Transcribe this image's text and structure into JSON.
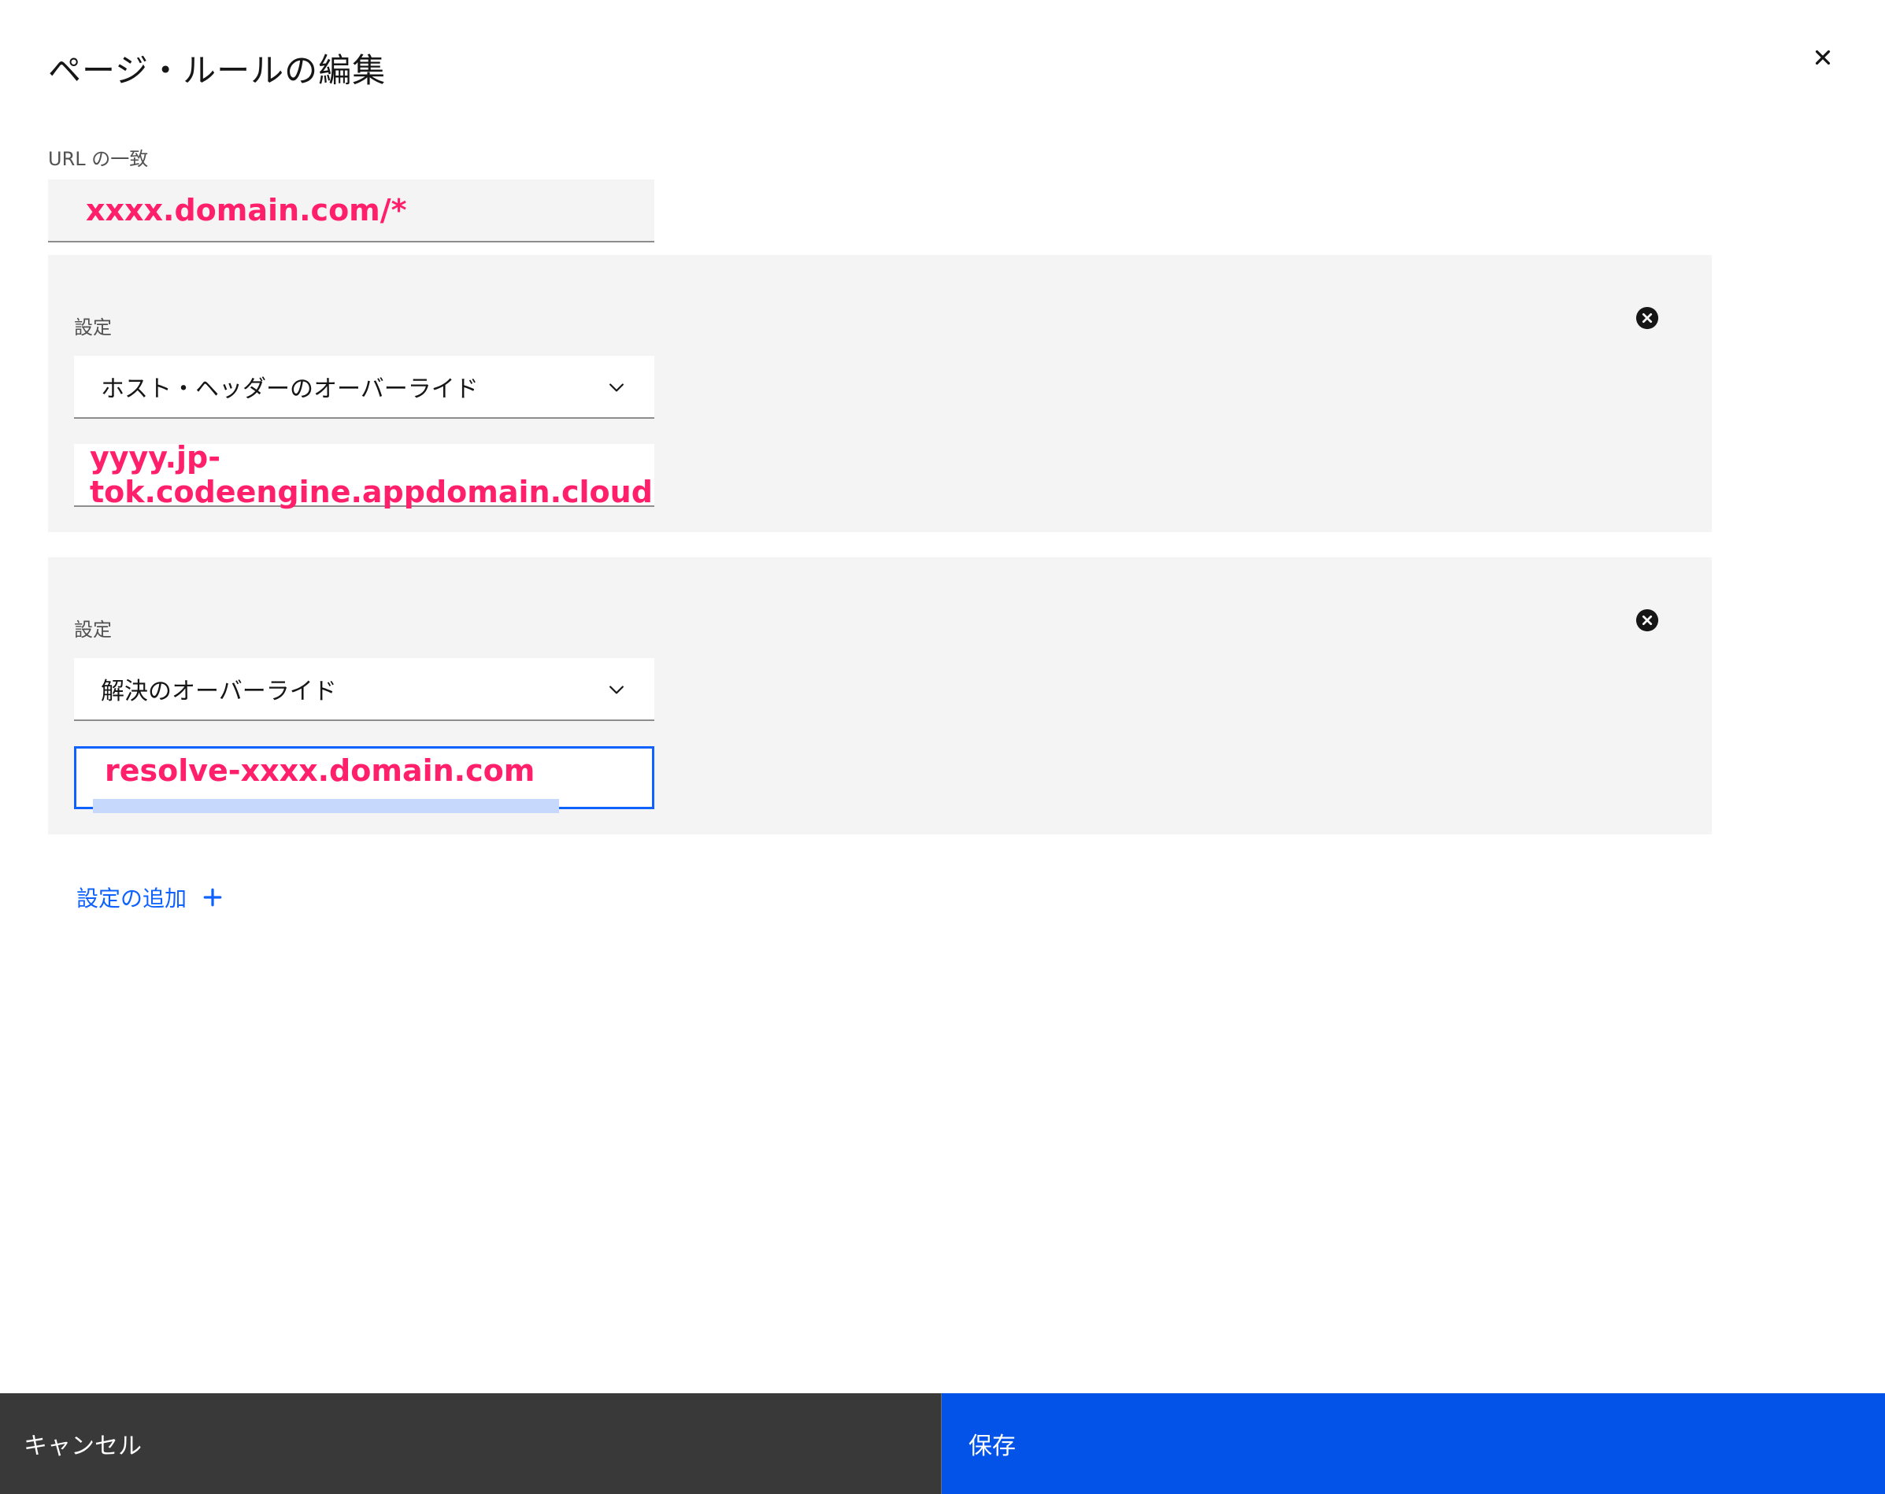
{
  "dialog": {
    "title": "ページ・ルールの編集"
  },
  "url_match": {
    "label": "URL の一致",
    "value": "xxxx.domain.com/*"
  },
  "settings": [
    {
      "label": "設定",
      "selected": "ホスト・ヘッダーのオーバーライド",
      "value": "yyyy.jp-tok.codeengine.appdomain.cloud"
    },
    {
      "label": "設定",
      "selected": "解決のオーバーライド",
      "value": "resolve-xxxx.domain.com"
    }
  ],
  "add_setting": {
    "label": "設定の追加"
  },
  "footer": {
    "cancel_label": "キャンセル",
    "save_label": "保存"
  },
  "colors": {
    "primary": "#0f62fe",
    "save_button": "#0353e9",
    "cancel_button": "#393939",
    "annotation_text": "#ff1f6a",
    "section_bg": "#f4f4f4"
  },
  "icons": {
    "close": "close-icon",
    "remove": "remove-circle-icon",
    "dropdown": "chevron-down-icon",
    "add": "plus-icon"
  }
}
